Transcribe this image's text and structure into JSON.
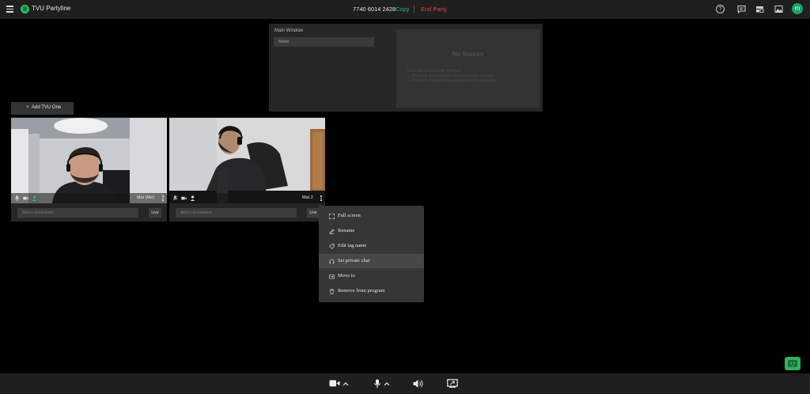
{
  "topbar": {
    "app_title": "TVU Partyline",
    "session_id": "7740 6014 2428",
    "copy_label": "Copy",
    "end_label": "End Party",
    "avatar_letter": "m",
    "icons": [
      "menu-icon",
      "help-icon",
      "chat-icon",
      "layout-icon",
      "image-icon"
    ]
  },
  "main_window": {
    "label": "Main Window",
    "select_value": "None",
    "no_source_title": "No Source",
    "instructions": [
      "Establish contact with Producer:",
      "1. Producer and Partyline keep the same account.",
      "2. Producer PGM will be synchronized to Partyline."
    ]
  },
  "add_button": {
    "label": "Add TVU One"
  },
  "tiles": [
    {
      "name": "Mat (Me)",
      "dest_placeholder": "Select destination",
      "live_label": "Live"
    },
    {
      "name": "Mat 2",
      "dest_placeholder": "Select destination",
      "live_label": "Live"
    }
  ],
  "context_menu": {
    "items": [
      {
        "label": "Full screen",
        "icon": "fullscreen-icon"
      },
      {
        "label": "Rename",
        "icon": "pencil-icon"
      },
      {
        "label": "Edit tag name",
        "icon": "tag-icon"
      },
      {
        "label": "Set private chat",
        "icon": "headset-icon",
        "highlighted": true
      },
      {
        "label": "Move to",
        "icon": "move-icon"
      },
      {
        "label": "Remove from program",
        "icon": "trash-icon"
      }
    ]
  },
  "bottombar": {
    "icons": [
      "camera-icon",
      "chevron-up-icon",
      "microphone-icon",
      "chevron-up-icon",
      "speaker-icon",
      "screen-share-icon"
    ]
  },
  "colors": {
    "accent_green": "#2fb86c",
    "danger_red": "#e04343",
    "bar_bg": "#1f1f1f",
    "panel_bg": "#262626"
  }
}
